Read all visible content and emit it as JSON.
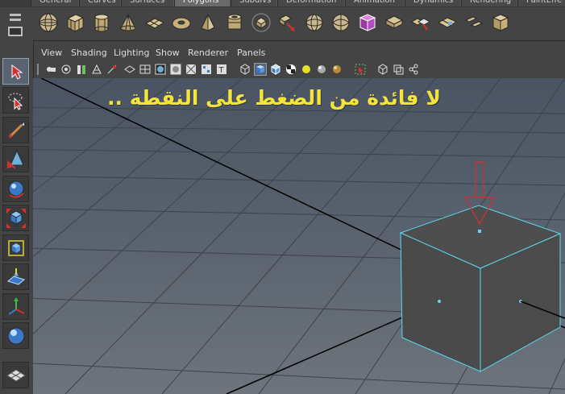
{
  "shelf": {
    "tabs": [
      "General",
      "Curves",
      "Surfaces",
      "Polygons",
      "Subdivs",
      "Deformation",
      "Animation",
      "Dynamics",
      "Rendering",
      "PaintEffe"
    ],
    "active_tab": "Polygons",
    "icons": [
      "poly-sphere-icon",
      "poly-cube-icon",
      "poly-cylinder-icon",
      "poly-cone-icon",
      "poly-plane-icon",
      "poly-torus-icon",
      "poly-pyramid-icon",
      "poly-pipe-icon",
      "poly-helix-icon",
      "poly-soccerball-icon",
      "combine-icon",
      "separate-icon",
      "smooth-icon",
      "sphere-wire-icon",
      "bevel-icon",
      "extrude-icon",
      "bridge-icon",
      "append-polygon-icon",
      "split-polygon-icon",
      "merge-icon",
      "cut-faces-icon",
      "uv-icon"
    ]
  },
  "left_tools": [
    "select-tool-icon",
    "lasso-tool-icon",
    "paint-select-tool-icon",
    "move-tool-icon",
    "rotate-tool-icon",
    "scale-tool-icon",
    "universal-manipulator-icon",
    "soft-modification-icon",
    "show-manipulator-icon",
    "last-tool-icon",
    "outliner-layout-icon"
  ],
  "panel": {
    "menus": [
      "View",
      "Shading",
      "Lighting",
      "Show",
      "Renderer",
      "Panels"
    ]
  },
  "viewport": {
    "annotation": "لا فائدة من الضغط على النقطة ..",
    "annotation_color": "#f4e43b",
    "selection_color": "#5ad8f0",
    "arrow_color": "#d43030"
  }
}
